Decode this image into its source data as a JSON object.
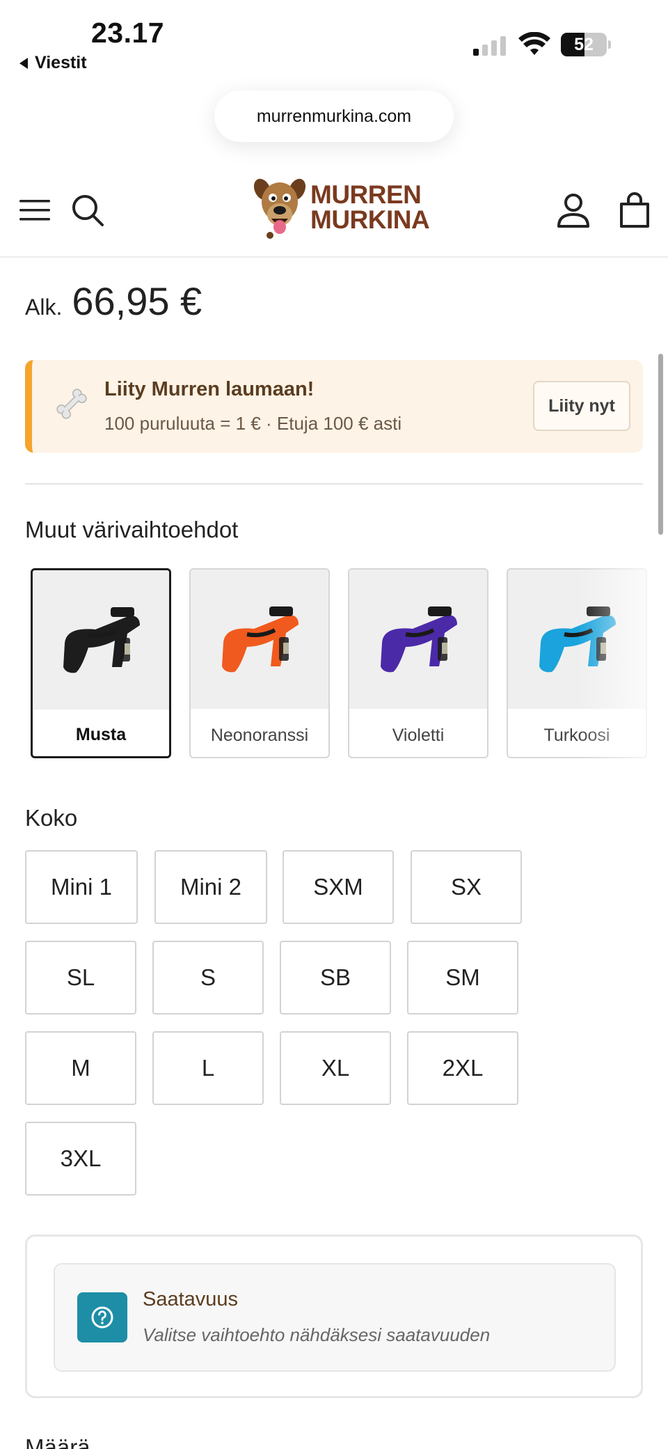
{
  "status_bar": {
    "time": "23.17",
    "back_label": "Viestit",
    "battery_percent": "52",
    "battery_level": 0.52
  },
  "browser": {
    "url": "murrenmurkina.com"
  },
  "header": {
    "logo_line1": "MURREN",
    "logo_line2": "MURKINA",
    "icons": [
      "menu-icon",
      "search-icon",
      "account-icon",
      "cart-icon"
    ]
  },
  "product": {
    "price_prefix": "Alk.",
    "price": "66,95 €"
  },
  "loyalty": {
    "title": "Liity Murren laumaan!",
    "subtitle": "100 puruluuta = 1 € · Etuja 100 € asti",
    "button": "Liity nyt",
    "accent_color": "#f5a42c"
  },
  "colors_section": {
    "heading": "Muut värivaihtoehdot",
    "options": [
      {
        "label": "Musta",
        "color": "#1d1d1d",
        "selected": true
      },
      {
        "label": "Neonoranssi",
        "color": "#f05a1e",
        "selected": false
      },
      {
        "label": "Violetti",
        "color": "#4b2aa8",
        "selected": false
      },
      {
        "label": "Turkoosi",
        "color": "#1aa3dc",
        "selected": false
      }
    ]
  },
  "size_section": {
    "heading": "Koko",
    "sizes": [
      "Mini 1",
      "Mini 2",
      "SXM",
      "SX",
      "SL",
      "S",
      "SB",
      "SM",
      "M",
      "L",
      "XL",
      "2XL",
      "3XL"
    ]
  },
  "availability": {
    "title": "Saatavuus",
    "subtitle": "Valitse vaihtoehto nähdäksesi saatavuuden",
    "icon_color": "#1d8ea6"
  },
  "quantity": {
    "heading": "Määrä"
  }
}
